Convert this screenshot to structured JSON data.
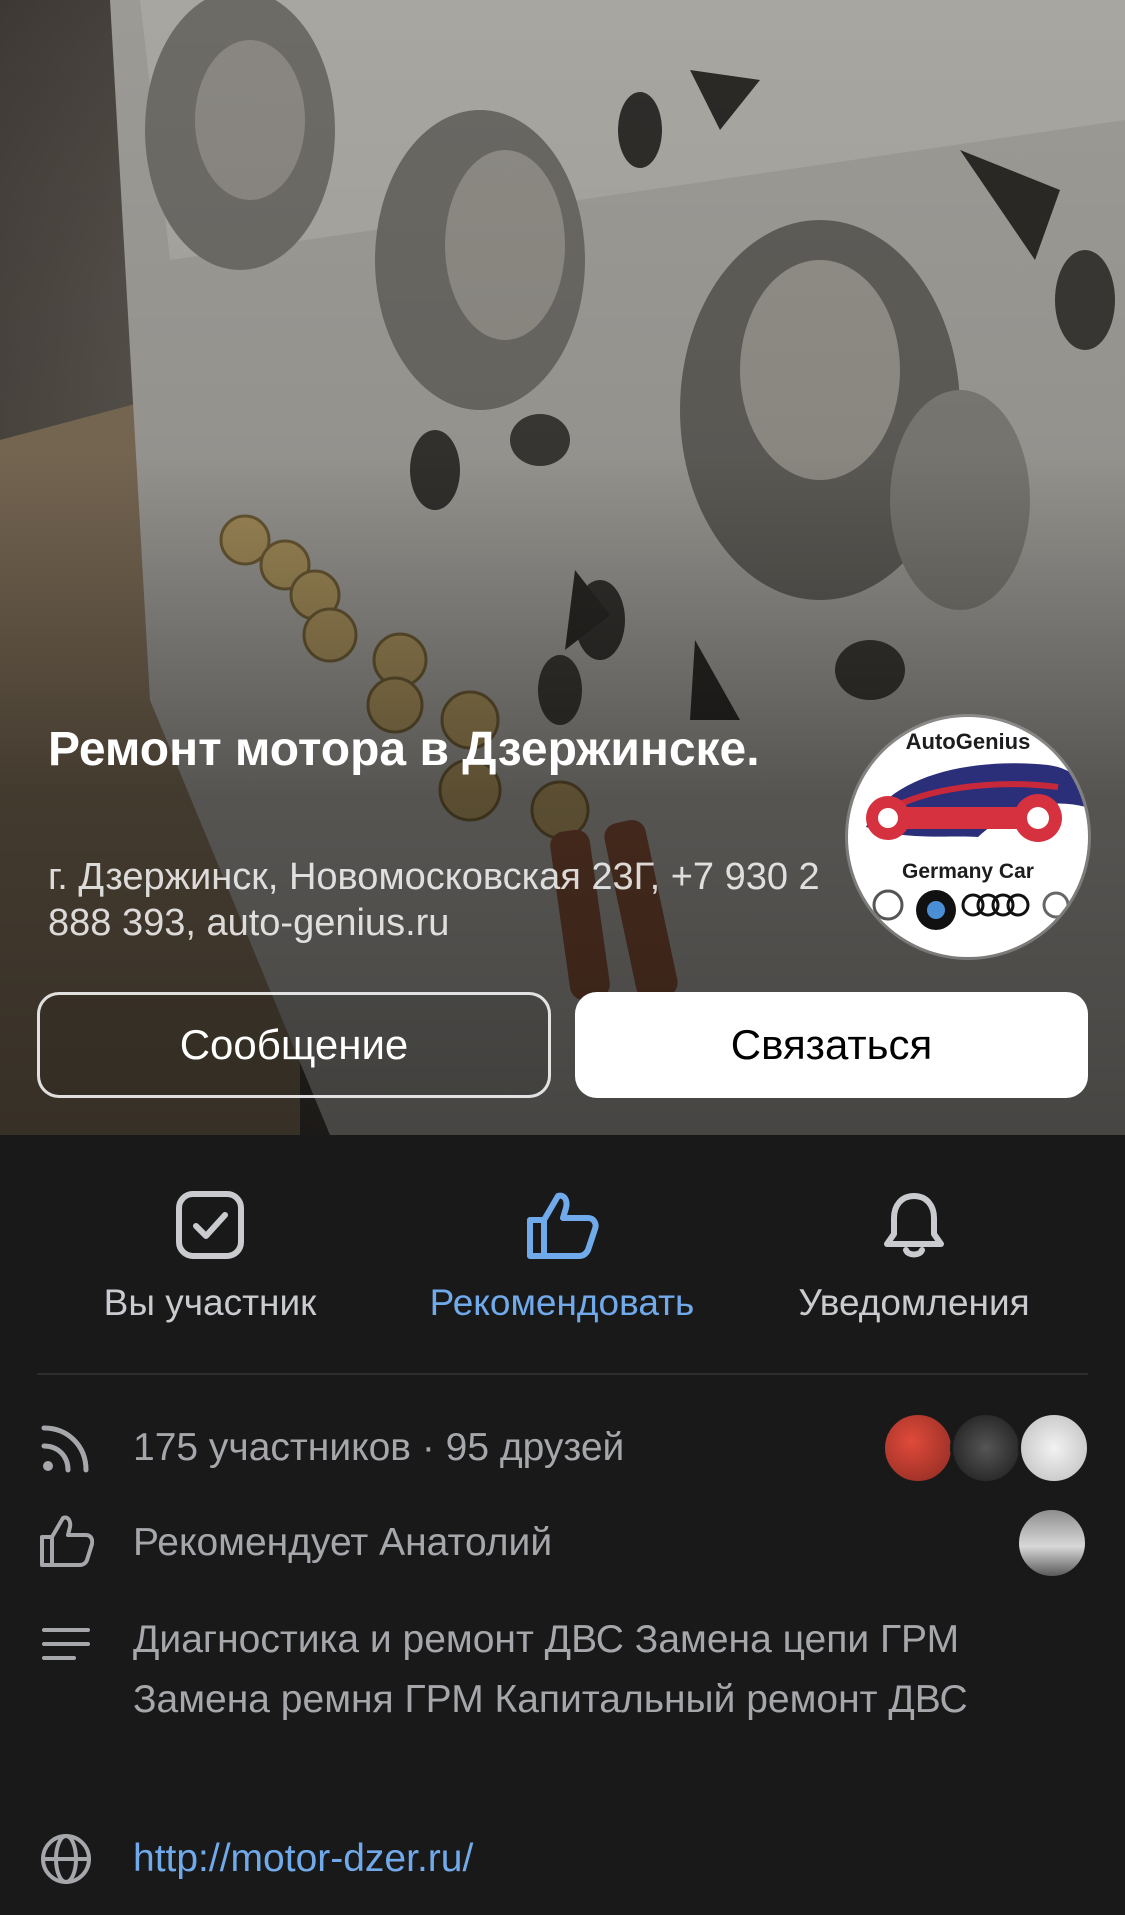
{
  "cover": {
    "title": "Ремонт мотора в Дзержинске.",
    "address": "г. Дзержинск, Новомосковская 23Г, +7 930 2 888 393, auto-genius.ru",
    "logo": {
      "top_text": "AutoGenius",
      "bottom_text": "Germany Car"
    },
    "message_label": "Сообщение",
    "contact_label": "Связаться"
  },
  "actions": [
    {
      "label": "Вы участник",
      "icon": "check-square-icon"
    },
    {
      "label": "Рекомендовать",
      "icon": "thumbs-up-icon",
      "color": "#71aaeb"
    },
    {
      "label": "Уведомления",
      "icon": "bell-icon"
    }
  ],
  "info": {
    "members": "175 участников · 95 друзей",
    "recommends": "Рекомендует Анатолий",
    "description": "Диагностика и ремонт ДВС Замена цепи ГРМ Замена ремня ГРМ Капитальный ремонт ДВС",
    "website": "http://motor-dzer.ru/"
  },
  "colors": {
    "background": "#19191a",
    "accent": "#71aaeb",
    "secondary_text": "#a5a7ab"
  }
}
